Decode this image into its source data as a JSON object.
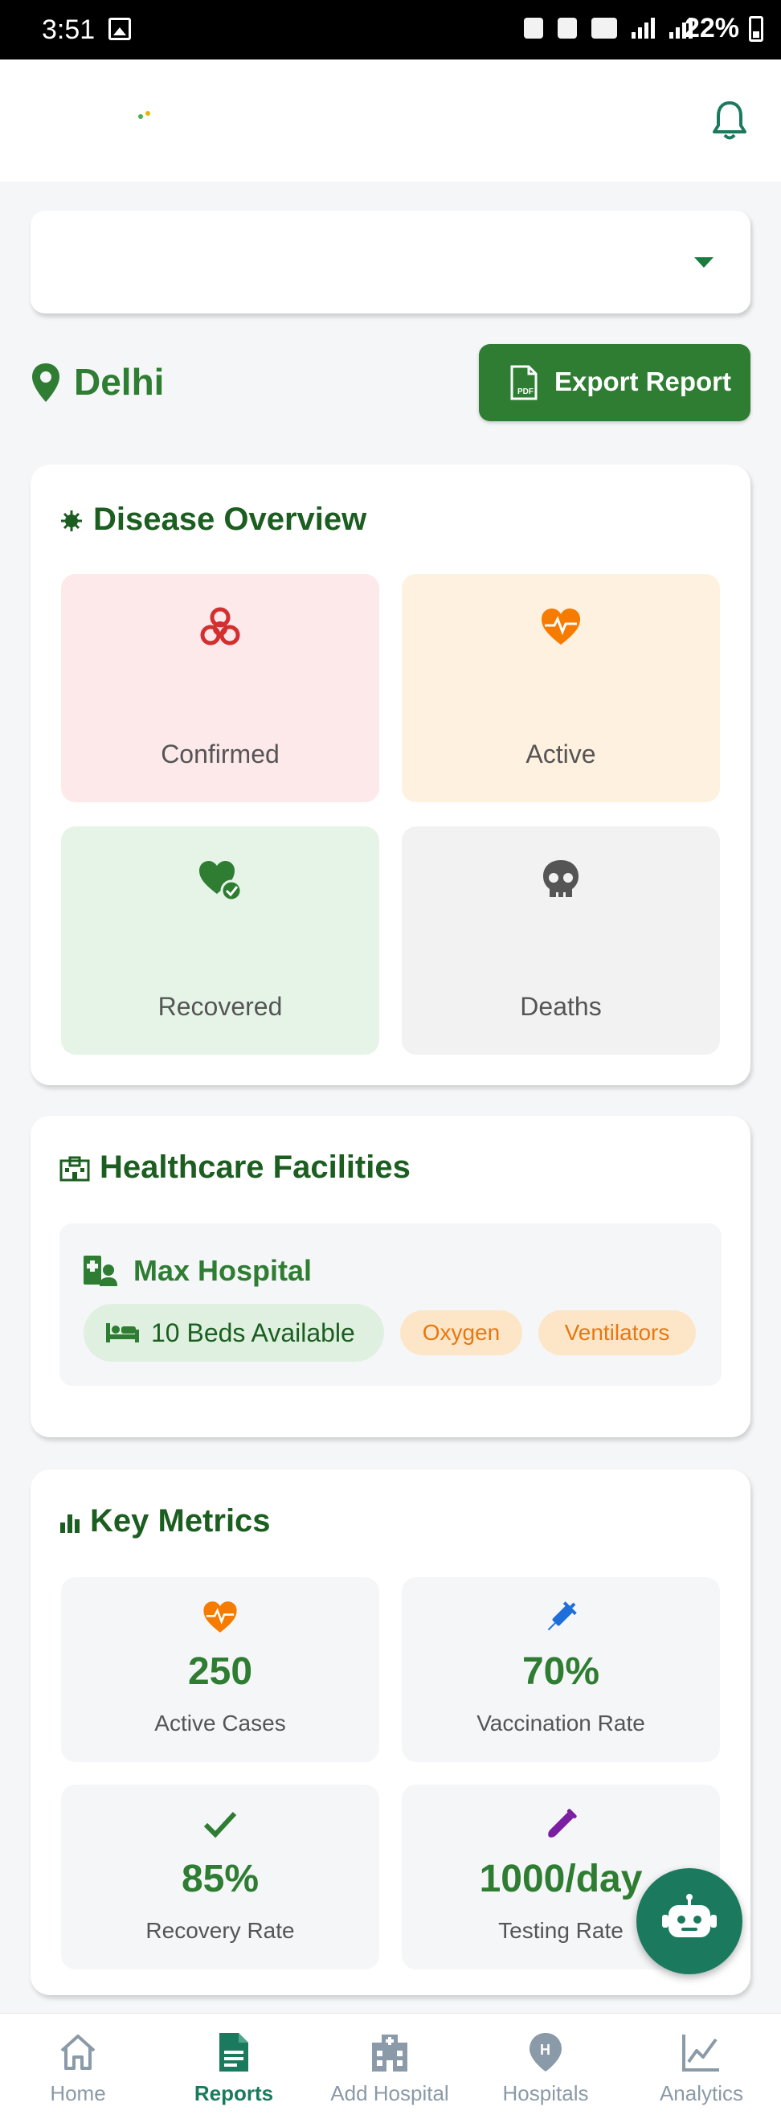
{
  "status_bar": {
    "time": "3:51",
    "battery": "22%"
  },
  "location": {
    "name": "Delhi"
  },
  "actions": {
    "export_label": "Export Report"
  },
  "disease_overview": {
    "title": "Disease Overview",
    "tiles": [
      {
        "label": "Confirmed",
        "icon": "biohazard-icon",
        "bg": "#fde8ea",
        "color": "#d32f2f"
      },
      {
        "label": "Active",
        "icon": "heart-pulse-icon",
        "bg": "#fff1df",
        "color": "#f57c00"
      },
      {
        "label": "Recovered",
        "icon": "heart-check-icon",
        "bg": "#e6f4e7",
        "color": "#2e7d32"
      },
      {
        "label": "Deaths",
        "icon": "skull-icon",
        "bg": "#f2f2f2",
        "color": "#555555"
      }
    ]
  },
  "facilities": {
    "title": "Healthcare Facilities",
    "hospital": {
      "name": "Max Hospital",
      "beds": "10 Beds Available",
      "tags": [
        "Oxygen",
        "Ventilators"
      ]
    }
  },
  "metrics": {
    "title": "Key Metrics",
    "items": [
      {
        "value": "250",
        "label": "Active Cases",
        "icon": "heart-pulse-icon"
      },
      {
        "value": "70%",
        "label": "Vaccination Rate",
        "icon": "syringe-icon"
      },
      {
        "value": "85%",
        "label": "Recovery Rate",
        "icon": "check-icon"
      },
      {
        "value": "1000/day",
        "label": "Testing Rate",
        "icon": "test-tube-icon"
      }
    ]
  },
  "nav": {
    "items": [
      {
        "label": "Home",
        "icon": "home-icon"
      },
      {
        "label": "Reports",
        "icon": "report-icon",
        "active": true
      },
      {
        "label": "Add Hospital",
        "icon": "hospital-icon"
      },
      {
        "label": "Hospitals",
        "icon": "hospital-pin-icon"
      },
      {
        "label": "Analytics",
        "icon": "chart-line-icon"
      }
    ]
  },
  "colors": {
    "primary": "#2e7d32",
    "dark_green": "#1b5e20",
    "teal": "#1b7a5e",
    "orange": "#f57c00"
  }
}
